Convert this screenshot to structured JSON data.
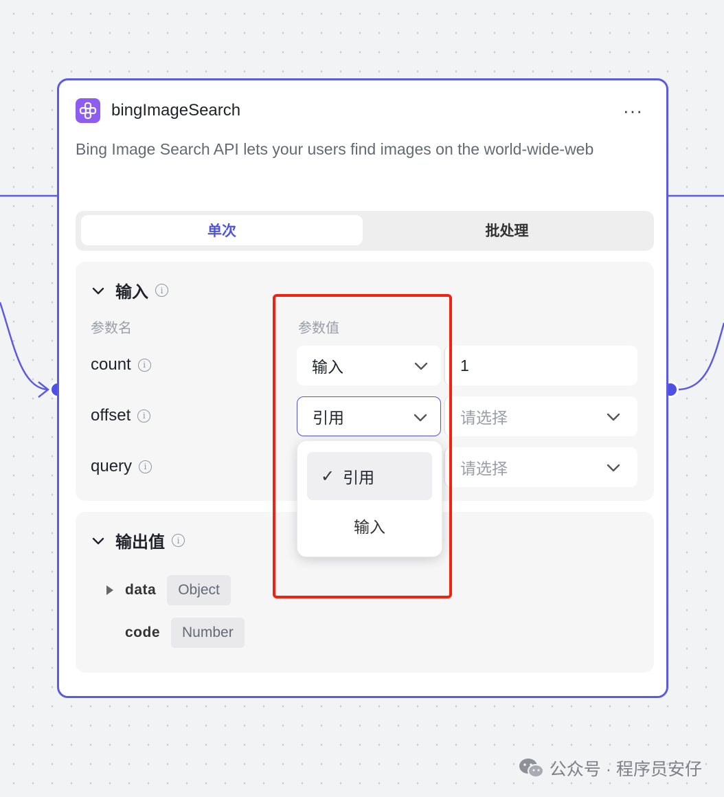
{
  "node": {
    "title": "bingImageSearch",
    "description": "Bing Image Search API lets your users find images on the world-wide-web",
    "more_label": "···",
    "accent_color": "#5a5be0",
    "icon": "plugin-icon",
    "tabs": [
      {
        "label": "单次",
        "active": true
      },
      {
        "label": "批处理",
        "active": false
      }
    ]
  },
  "inputs": {
    "section_title": "输入",
    "col_name_label": "参数名",
    "col_value_label": "参数值",
    "params": [
      {
        "name": "count",
        "type": "输入",
        "value": "1"
      },
      {
        "name": "offset",
        "type": "引用",
        "value_placeholder": "请选择"
      },
      {
        "name": "query",
        "type": "引用",
        "value_placeholder": "请选择"
      }
    ]
  },
  "type_dropdown": {
    "options": [
      {
        "label": "引用",
        "selected": true,
        "check": "✓"
      },
      {
        "label": "输入",
        "selected": false
      }
    ]
  },
  "outputs": {
    "section_title": "输出值",
    "fields": [
      {
        "name": "data",
        "type": "Object",
        "expandable": true
      },
      {
        "name": "code",
        "type": "Number",
        "expandable": false
      }
    ]
  },
  "annotation": {
    "color": "#f2220f"
  },
  "watermark": {
    "text": "公众号 · 程序员安仔",
    "icon": "wechat-icon"
  }
}
